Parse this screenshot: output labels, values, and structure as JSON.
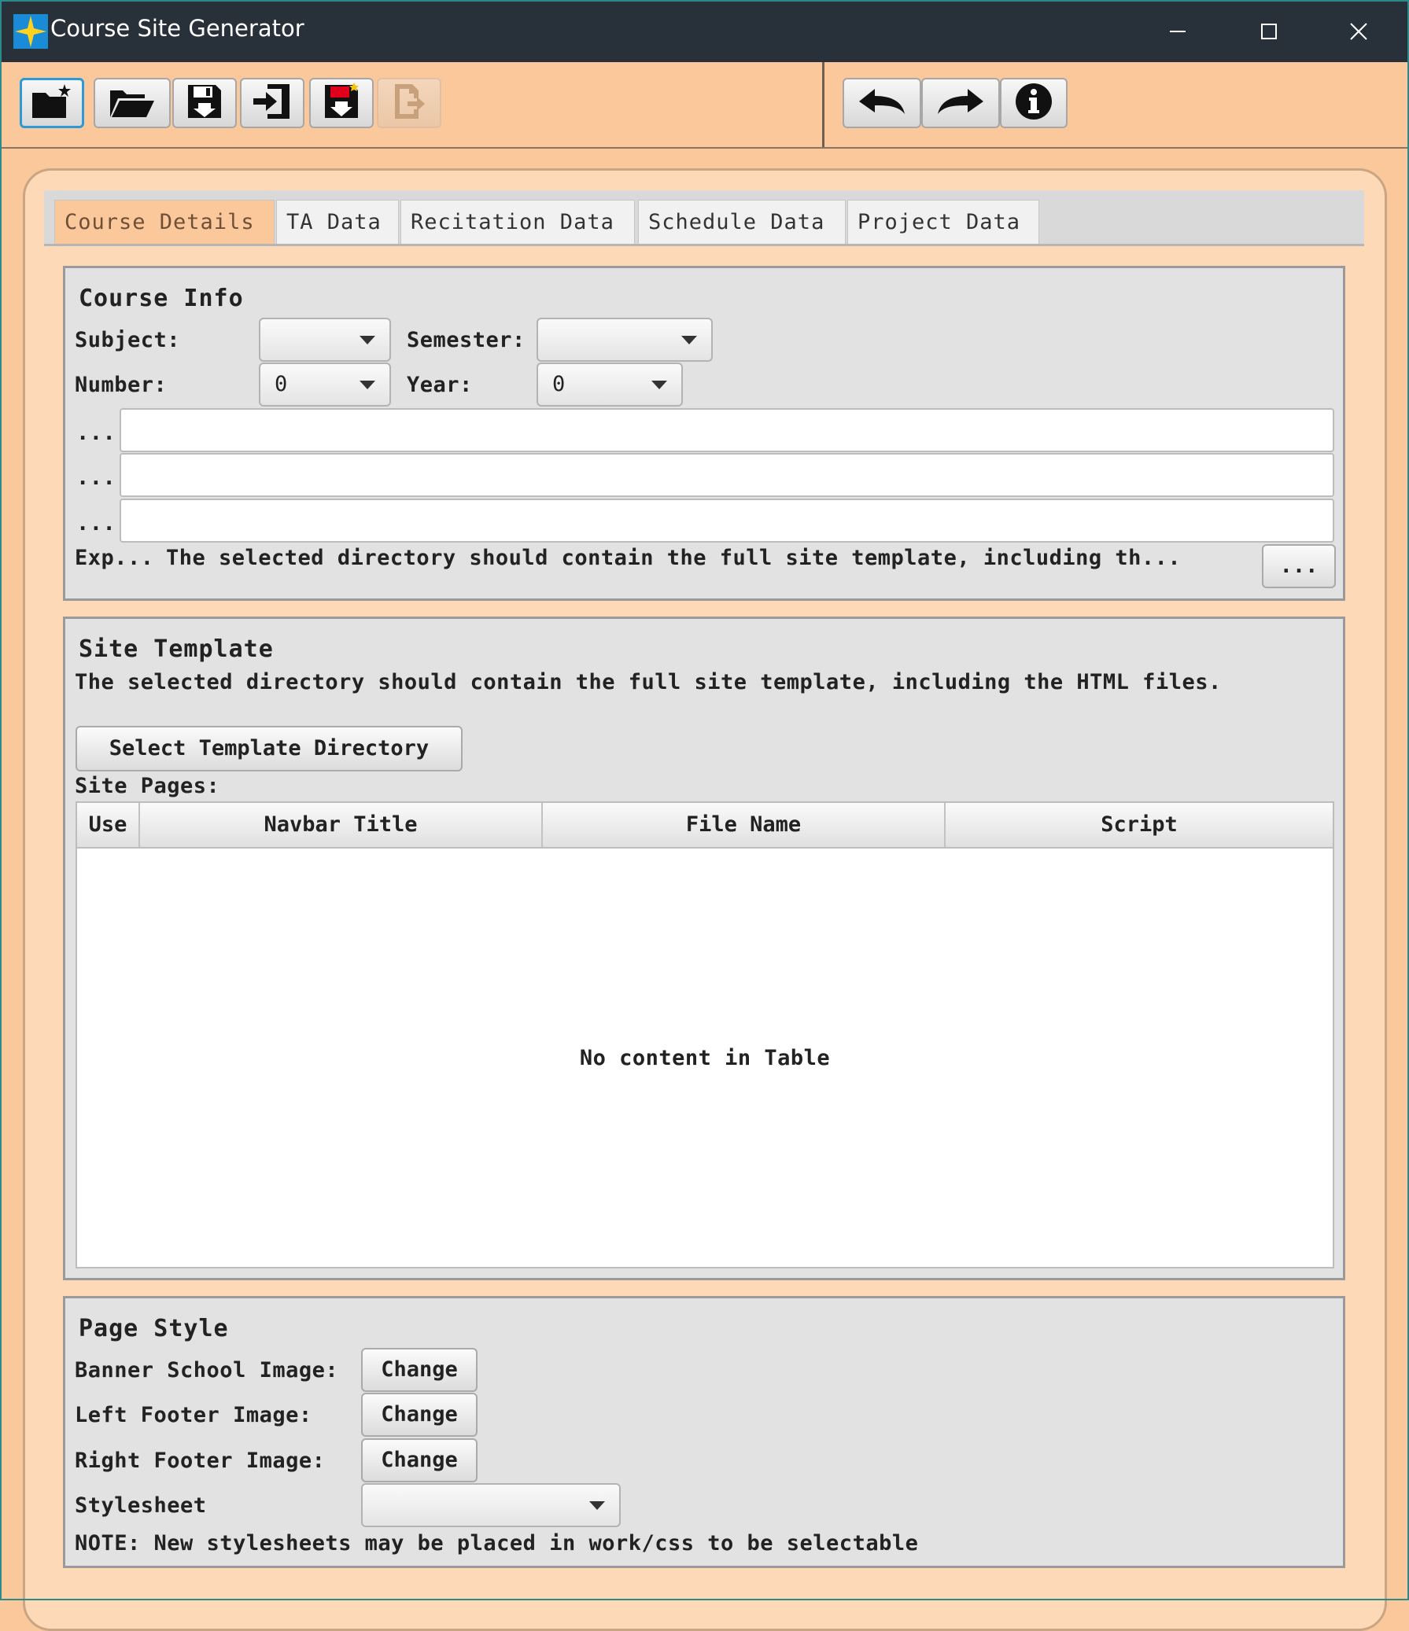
{
  "window": {
    "title": "Course Site Generator",
    "icon": "star-icon"
  },
  "toolbar": {
    "file_buttons": [
      {
        "name": "new-icon"
      },
      {
        "name": "open-folder-icon"
      },
      {
        "name": "save-icon"
      },
      {
        "name": "exit-icon"
      },
      {
        "name": "save-as-icon"
      },
      {
        "name": "export-icon",
        "disabled": true
      }
    ],
    "edit_buttons": [
      {
        "name": "undo-icon"
      },
      {
        "name": "redo-icon"
      },
      {
        "name": "info-icon"
      }
    ]
  },
  "tabs": [
    {
      "label": "Course Details",
      "selected": true
    },
    {
      "label": "TA Data"
    },
    {
      "label": "Recitation Data"
    },
    {
      "label": "Schedule Data"
    },
    {
      "label": "Project Data"
    }
  ],
  "course_info": {
    "title": "Course Info",
    "subject_label": "Subject:",
    "subject_value": "",
    "semester_label": "Semester:",
    "semester_value": "",
    "number_label": "Number:",
    "number_value": "0",
    "year_label": "Year:",
    "year_value": "0",
    "field_labels": [
      "...",
      "...",
      "..."
    ],
    "field_values": [
      "",
      "",
      ""
    ],
    "export_label": "Exp...",
    "export_text": "The selected directory should contain the full site template, including th...",
    "browse_label": "..."
  },
  "site_template": {
    "title": "Site Template",
    "description": "The selected directory should contain the full site template, including the HTML files.",
    "select_button": "Select Template Directory",
    "pages_label": "Site Pages:",
    "columns": [
      "Use",
      "Navbar Title",
      "File Name",
      "Script"
    ],
    "empty_text": "No content in Table"
  },
  "page_style": {
    "title": "Page Style",
    "banner_label": "Banner School Image:",
    "left_footer_label": "Left Footer Image:",
    "right_footer_label": "Right Footer Image:",
    "change_label": "Change",
    "stylesheet_label": "Stylesheet",
    "stylesheet_value": "",
    "note": "NOTE: New stylesheets may be placed in work/css to be selectable"
  },
  "colors": {
    "title_bar": "#283139",
    "background": "#fbc89b",
    "selected_tab": "#fbc89b",
    "section_bg": "#e2e2e2",
    "focus": "#2b9ad6"
  }
}
